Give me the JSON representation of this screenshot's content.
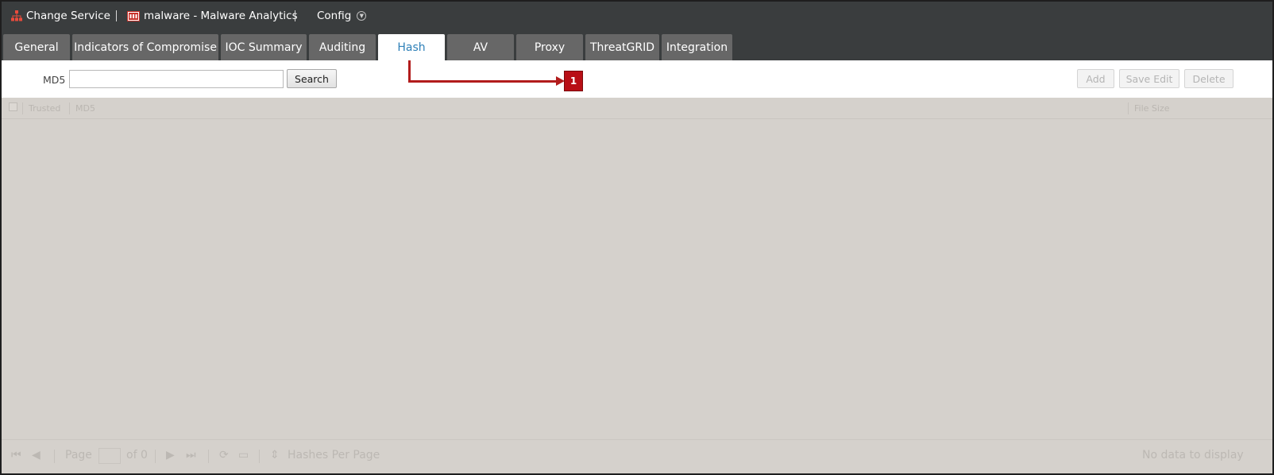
{
  "header": {
    "change_service": "Change Service",
    "service_name": "malware - Malware Analytics",
    "config": "Config",
    "icons": {
      "change_service": "network-tree-icon",
      "service": "malware-service-icon",
      "config": "chevron-down-circle-icon"
    }
  },
  "tabs": [
    {
      "label": "General"
    },
    {
      "label": "Indicators of Compromise"
    },
    {
      "label": "IOC Summary"
    },
    {
      "label": "Auditing"
    },
    {
      "label": "Hash",
      "active": true
    },
    {
      "label": "AV"
    },
    {
      "label": "Proxy"
    },
    {
      "label": "ThreatGRID"
    },
    {
      "label": "Integration"
    }
  ],
  "toolbar": {
    "md5_label": "MD5",
    "md5_value": "",
    "search_label": "Search",
    "add_label": "Add",
    "save_edit_label": "Save Edit",
    "delete_label": "Delete"
  },
  "callout": {
    "number": "1",
    "color": "#b80f16"
  },
  "grid": {
    "columns": [
      "Trusted",
      "MD5",
      "File Size"
    ]
  },
  "pager": {
    "page_label": "Page",
    "page_value": "",
    "of_label": "of 0",
    "per_page_label": "Hashes Per Page",
    "status": "No data to display"
  },
  "colors": {
    "header_bg": "#3a3d3e",
    "tab_bg": "#676767",
    "tab_active_text": "#2e80b8",
    "grid_bg": "#d5d1cc",
    "accent_red": "#b21c1c"
  }
}
